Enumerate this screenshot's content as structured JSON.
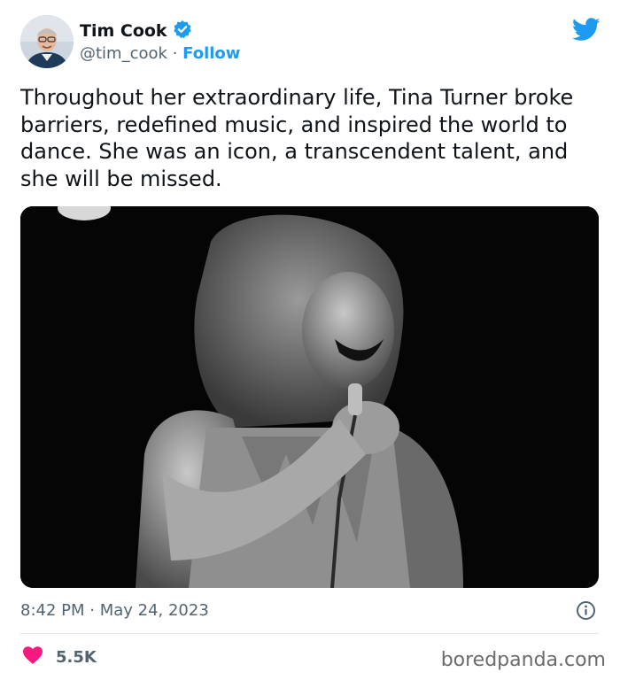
{
  "author": {
    "name": "Tim Cook",
    "handle": "@tim_cook",
    "separator": "·",
    "follow_label": "Follow",
    "verified": true
  },
  "icons": {
    "verified": "verified-badge-icon",
    "platform": "twitter-bird-icon",
    "info": "info-icon",
    "like": "heart-icon"
  },
  "tweet": {
    "text": "Throughout her extraordinary life, Tina Turner broke barriers, redefined music, and inspired the world to dance. She was an icon, a transcendent talent, and she will be missed.",
    "timestamp": "8:42 PM · May 24, 2023",
    "likes": "5.5K"
  },
  "watermark": "boredpanda.com",
  "colors": {
    "accent": "#1d9bf0",
    "text": "#0f1419",
    "muted": "#536471",
    "like": "#f91880",
    "divider": "#e1e8ed"
  }
}
